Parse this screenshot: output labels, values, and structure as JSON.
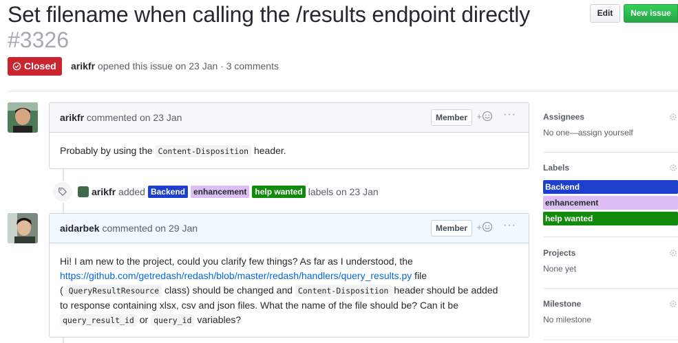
{
  "issue": {
    "title": "Set filename when calling the /results endpoint directly",
    "number": "#3326",
    "state": "Closed",
    "author": "arikfr",
    "meta_text": "opened this issue on 23 Jan · 3 comments"
  },
  "header_buttons": {
    "edit": "Edit",
    "new_issue": "New issue"
  },
  "comments": [
    {
      "author": "arikfr",
      "action": "commented on 23 Jan",
      "role": "Member",
      "reaction": "+",
      "more": "···",
      "body_before": "Probably by using the ",
      "body_code": "Content-Disposition",
      "body_after": " header."
    },
    {
      "author": "aidarbek",
      "action": "commented on 29 Jan",
      "role": "Member",
      "reaction": "+",
      "more": "···",
      "line1": "Hi! I am new to the project, could you clarify few things? As far as I understood, the",
      "link": "https://github.com/getredash/redash/blob/master/redash/handlers/query_results.py",
      "after_link": " file",
      "paren_open": "( ",
      "code1": "QueryResultResource",
      "mid1": " class) should be changed and ",
      "code2": "Content-Disposition",
      "mid2": " header should be added",
      "line4": "to response containing xlsx, csv and json files. What the name of the file should be? Can it be",
      "code3": "query_result_id",
      "mid3": " or ",
      "code4": "query_id",
      "tail": " variables?"
    }
  ],
  "label_event": {
    "actor": "arikfr",
    "verb": "added",
    "labels": [
      "Backend",
      "enhancement",
      "help wanted"
    ],
    "suffix": "labels on 23 Jan"
  },
  "sidebar": {
    "assignees": {
      "heading": "Assignees",
      "value": "No one—assign yourself"
    },
    "labels": {
      "heading": "Labels",
      "items": [
        "Backend",
        "enhancement",
        "help wanted"
      ]
    },
    "projects": {
      "heading": "Projects",
      "value": "None yet"
    },
    "milestone": {
      "heading": "Milestone",
      "value": "No milestone"
    }
  },
  "colors": {
    "closed": "#cb2431",
    "new_issue": "#28a745",
    "label_backend": "#1d3fcd",
    "label_enhancement": "#dcbef5",
    "label_help_wanted": "#128a0c",
    "link": "#0366d6"
  },
  "icons": {
    "state": "issue-closed-icon",
    "tag": "tag-icon",
    "reaction": "smiley-icon",
    "settings": "gear-icon"
  }
}
